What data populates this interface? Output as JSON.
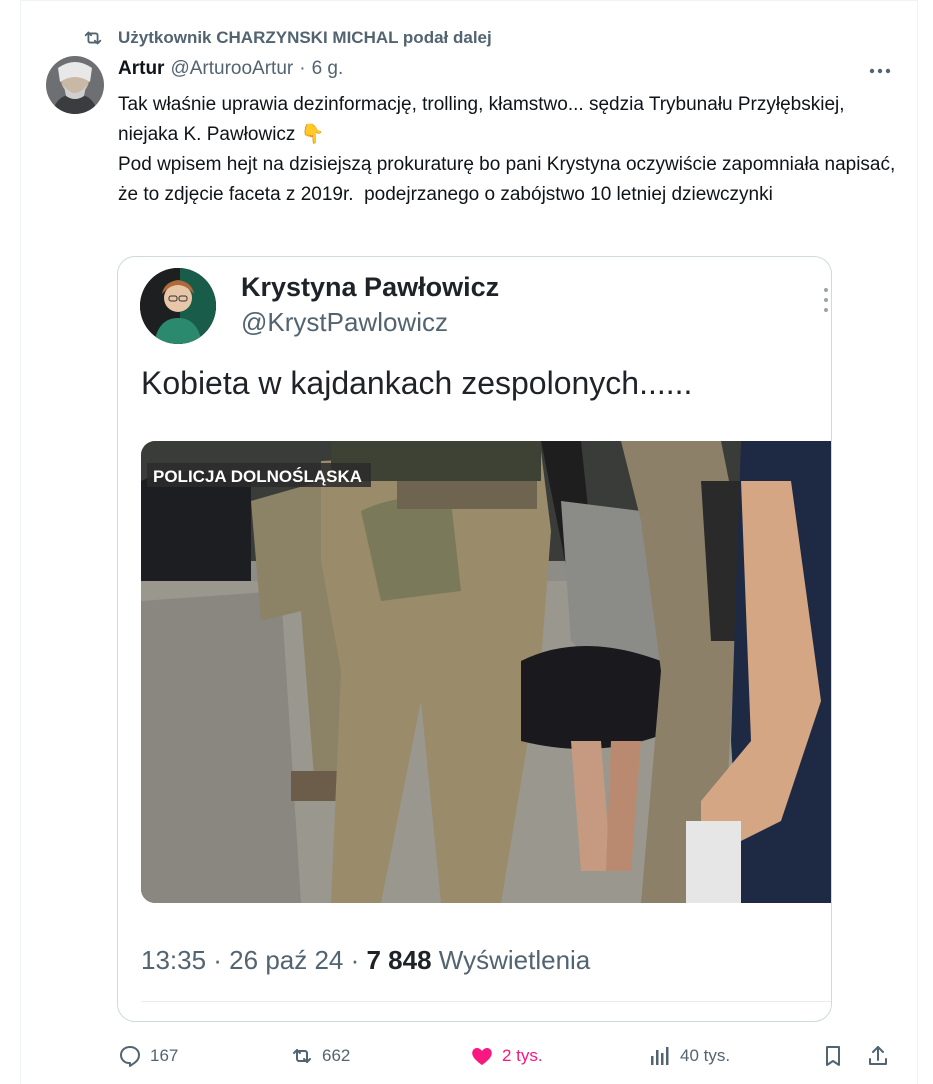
{
  "retweet_banner": "Użytkownik CHARZYNSKI MICHAL podał dalej",
  "author": {
    "name": "Artur",
    "handle": "@ArturooArtur",
    "separator": "·",
    "time": "6 g."
  },
  "tweet_text": "Tak właśnie uprawia dezinformację, trolling, kłamstwo... sędzia Trybunału Przyłębskiej, niejaka K. Pawłowicz 👇\nPod wpisem hejt na dzisiejszą prokuraturę bo pani Krystyna oczywiście zapomniała napisać, że to zdjęcie faceta z 2019r.  podejrzanego o zabójstwo 10 letniej dziewczynki",
  "embedded": {
    "name": "Krystyna Pawłowicz",
    "handle": "@KrystPawlowicz",
    "text": "Kobieta w kajdankach zespolonych......",
    "photo_caption": "POLICJA DOLNOŚLĄSKA",
    "time": "13:35 · 26 paź 24 · ",
    "views_count": "7 848",
    "views_label": " Wyświetlenia"
  },
  "actions": {
    "replies": "167",
    "retweets": "662",
    "likes": "2 tys.",
    "views": "40 tys."
  },
  "colors": {
    "like": "#f91880",
    "muted": "#536471",
    "text": "#0f1419"
  },
  "icons": [
    "retweet-icon",
    "more-icon",
    "reply-icon",
    "like-icon",
    "views-icon",
    "bookmark-icon",
    "share-icon"
  ]
}
